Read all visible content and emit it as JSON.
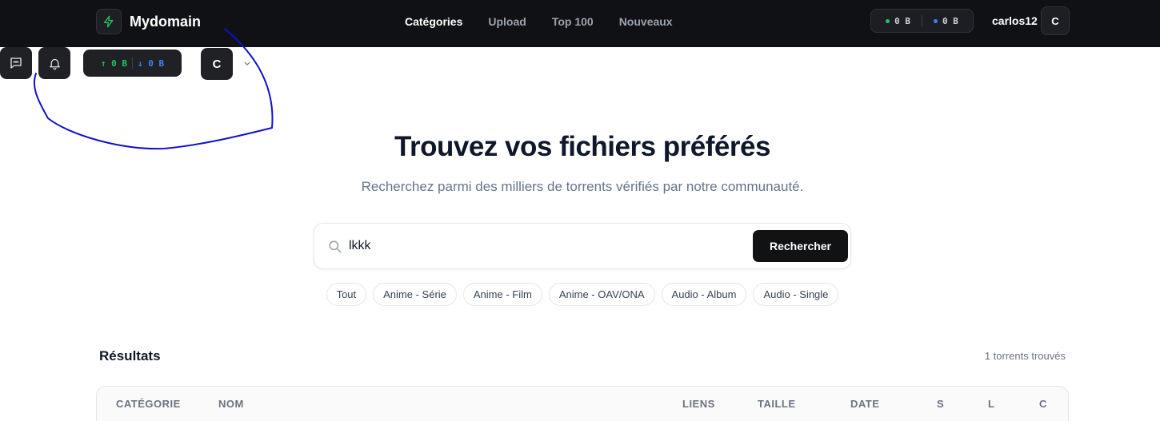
{
  "brand": {
    "name": "Mydomain",
    "icon": "bolt-icon"
  },
  "nav": {
    "items": [
      {
        "label": "Catégories",
        "active": true
      },
      {
        "label": "Upload",
        "active": false
      },
      {
        "label": "Top 100",
        "active": false
      },
      {
        "label": "Nouveaux",
        "active": false
      }
    ]
  },
  "header_stats": {
    "upload": "0 B",
    "download": "0 B",
    "upload_color": "#22c55e",
    "download_color": "#3b82f6"
  },
  "user": {
    "name": "carlos12",
    "initial": "C"
  },
  "toolbar": {
    "chat_icon": "chat-icon",
    "bell_icon": "bell-icon",
    "upload": "0 B",
    "download": "0 B",
    "avatar_initial": "C",
    "menu_icon": "chevron-down-icon"
  },
  "hero": {
    "title": "Trouvez vos fichiers préférés",
    "subtitle": "Recherchez parmi des milliers de torrents vérifiés par notre communauté."
  },
  "search": {
    "value": "lkkk",
    "button_label": "Rechercher"
  },
  "categories": [
    "Tout",
    "Anime - Série",
    "Anime - Film",
    "Anime - OAV/ONA",
    "Audio - Album",
    "Audio - Single"
  ],
  "results": {
    "title": "Résultats",
    "count": "1 torrents trouvés",
    "columns": [
      "CATÉGORIE",
      "NOM",
      "LIENS",
      "TAILLE",
      "DATE",
      "S",
      "L",
      "C"
    ]
  },
  "annotation_color": "#1010cc"
}
